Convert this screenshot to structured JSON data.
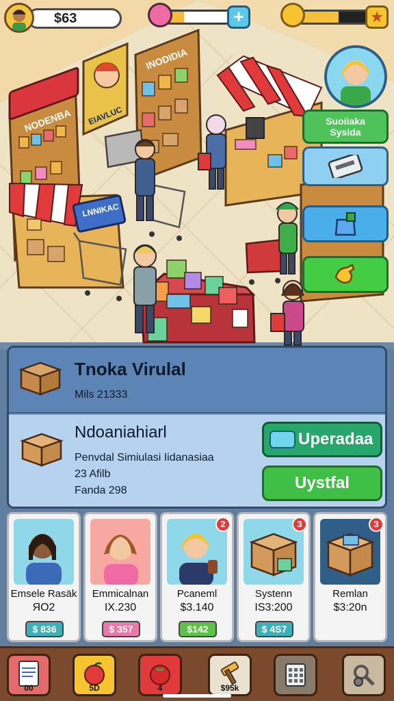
{
  "hud": {
    "money": "$63",
    "progress_level": 0.25,
    "xp_level": 0.55
  },
  "side_panel": {
    "top_button_label_1": "Suoiiaka",
    "top_button_label_2": "Sysida"
  },
  "signs": {
    "shelf_left": "NODENBA",
    "shelf_center": "INODIDIA",
    "poster": "EIAVLUC",
    "counter_left": "LNNIKAC"
  },
  "info_panel": {
    "title": "Tnoka Virulal",
    "subtitle": "Mils 21333",
    "title2": "Ndoaniahiarl",
    "line1": "Penvdal Simiulasi Iidanasiaa",
    "line2": "23 Afilb",
    "line3": "Fanda 298",
    "upgrade_label": "Uperadaa",
    "install_label": "Uystfal"
  },
  "cards": [
    {
      "name": "Emsele Rasäk",
      "price": "ЯО2",
      "badge": "$ 836",
      "badge_color": "#3fb0b8",
      "notif": ""
    },
    {
      "name": "Emmicalnan",
      "price": "IX.230",
      "badge": "$ 357",
      "badge_color": "#e77aa8",
      "notif": ""
    },
    {
      "name": "Pcaneml",
      "price": "$3.140",
      "badge": "$142",
      "badge_color": "#5ec24a",
      "notif": "2"
    },
    {
      "name": "Systenn",
      "price": "IS3:200",
      "badge": "$ 4S7",
      "badge_color": "#3fb0b8",
      "notif": "3"
    },
    {
      "name": "Remlan",
      "price": "$3:20n",
      "badge": "",
      "badge_color": "",
      "notif": "3"
    }
  ],
  "bottom_bar": {
    "tool1": "00",
    "tool2": "5D",
    "tool3": "4",
    "tool4": "$95k",
    "tool5": "",
    "tool6": ""
  }
}
